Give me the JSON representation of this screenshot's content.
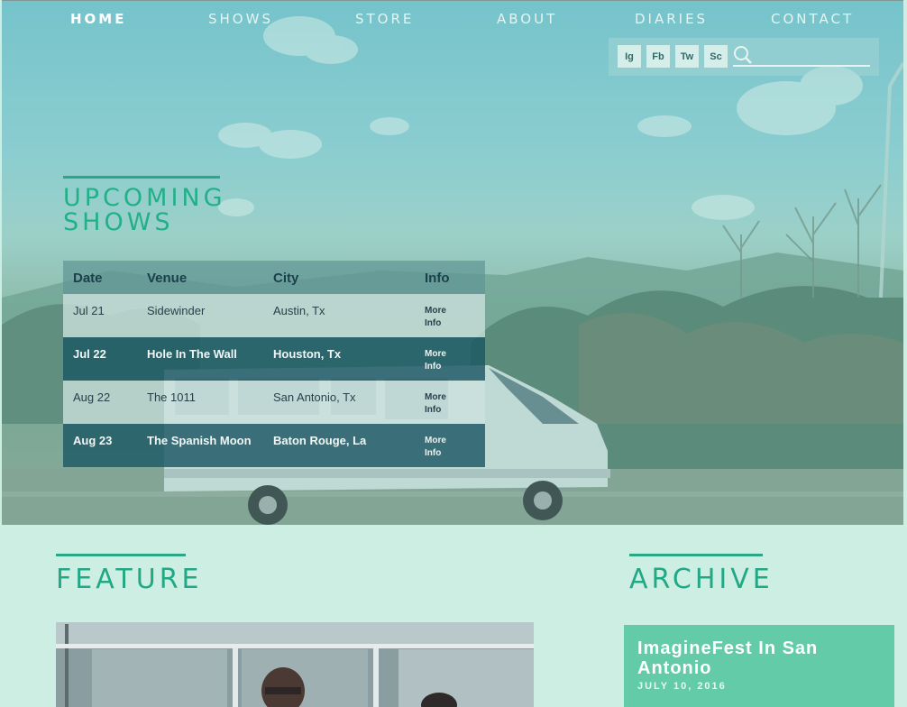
{
  "nav": {
    "items": [
      {
        "label": "HOME",
        "active": true
      },
      {
        "label": "SHOWS",
        "active": false
      },
      {
        "label": "STORE",
        "active": false
      },
      {
        "label": "ABOUT",
        "active": false
      },
      {
        "label": "DIARIES",
        "active": false
      },
      {
        "label": "CONTACT",
        "active": false
      }
    ]
  },
  "social": {
    "buttons": [
      "Ig",
      "Fb",
      "Tw",
      "Sc"
    ],
    "search_placeholder": ""
  },
  "upcoming": {
    "title_line1": "UPCOMING",
    "title_line2": "SHOWS",
    "columns": [
      "Date",
      "Venue",
      "City",
      "Info"
    ],
    "rows": [
      {
        "date": "Jul 21",
        "venue": "Sidewinder",
        "city": "Austin, Tx",
        "info": "More Info"
      },
      {
        "date": "Jul 22",
        "venue": "Hole In The Wall",
        "city": "Houston, Tx",
        "info": "More Info"
      },
      {
        "date": "Aug 22",
        "venue": "The 1011",
        "city": "San Antonio, Tx",
        "info": "More Info"
      },
      {
        "date": "Aug 23",
        "venue": "The Spanish Moon",
        "city": "Baton Rouge, La",
        "info": "More Info"
      }
    ]
  },
  "feature": {
    "title": "FEATURE"
  },
  "archive": {
    "title": "ARCHIVE",
    "card_title": "ImagineFest In San Antonio",
    "card_date": "JULY 10, 2016"
  },
  "colors": {
    "accent": "#22a884",
    "page_bg": "#cdeee3",
    "archive_card": "#63cba7",
    "table_dark_row": "#1c5864"
  }
}
